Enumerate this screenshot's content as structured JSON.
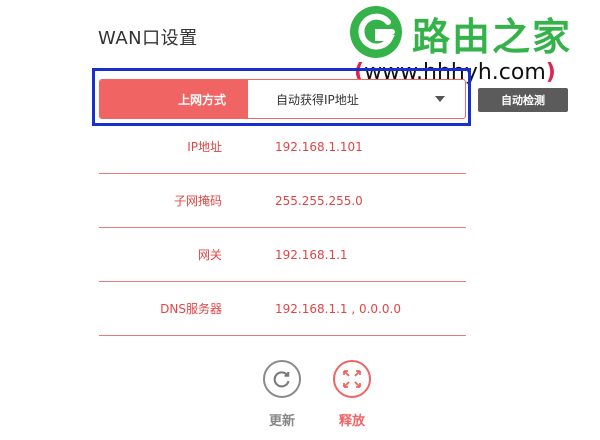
{
  "page": {
    "title": "WAN口设置"
  },
  "watermark": {
    "brand": "路由之家",
    "url": "www.hhhyh.com"
  },
  "wan": {
    "method_label": "上网方式",
    "method_value": "自动获得IP地址",
    "auto_detect_label": "自动检测",
    "fields": [
      {
        "label": "IP地址",
        "value": "192.168.1.101"
      },
      {
        "label": "子网掩码",
        "value": "255.255.255.0"
      },
      {
        "label": "网关",
        "value": "192.168.1.1"
      },
      {
        "label": "DNS服务器",
        "value": "192.168.1.1 , 0.0.0.0"
      }
    ]
  },
  "actions": {
    "refresh_label": "更新",
    "release_label": "释放"
  },
  "colors": {
    "accent": "#f06464",
    "text_red": "#e04545",
    "highlight": "#1a2fd0",
    "brand_green": "#35b34a",
    "refresh": "#888888"
  }
}
